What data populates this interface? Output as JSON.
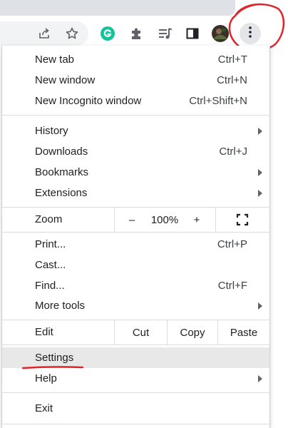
{
  "toolbar": {
    "icons": [
      "share-icon",
      "bookmark-star-icon",
      "grammarly-extension-icon",
      "extensions-puzzle-icon",
      "media-queue-icon",
      "side-panel-icon",
      "profile-avatar",
      "more-menu-icon"
    ],
    "accent_colors": {
      "grammarly": "#15c39a",
      "annotation": "#e0252b"
    }
  },
  "menu": {
    "group1": [
      {
        "label": "New tab",
        "shortcut": "Ctrl+T"
      },
      {
        "label": "New window",
        "shortcut": "Ctrl+N"
      },
      {
        "label": "New Incognito window",
        "shortcut": "Ctrl+Shift+N"
      }
    ],
    "group2": [
      {
        "label": "History",
        "shortcut": ""
      },
      {
        "label": "Downloads",
        "shortcut": "Ctrl+J"
      },
      {
        "label": "Bookmarks",
        "shortcut": ""
      },
      {
        "label": "Extensions",
        "shortcut": ""
      }
    ],
    "zoom": {
      "label": "Zoom",
      "minus": "–",
      "value": "100%",
      "plus": "+"
    },
    "group3": [
      {
        "label": "Print...",
        "shortcut": "Ctrl+P"
      },
      {
        "label": "Cast...",
        "shortcut": ""
      },
      {
        "label": "Find...",
        "shortcut": "Ctrl+F"
      },
      {
        "label": "More tools",
        "shortcut": ""
      }
    ],
    "edit": {
      "label": "Edit",
      "cut": "Cut",
      "copy": "Copy",
      "paste": "Paste"
    },
    "group4": [
      {
        "label": "Settings",
        "highlighted": true
      },
      {
        "label": "Help"
      }
    ],
    "exit": {
      "label": "Exit"
    }
  }
}
